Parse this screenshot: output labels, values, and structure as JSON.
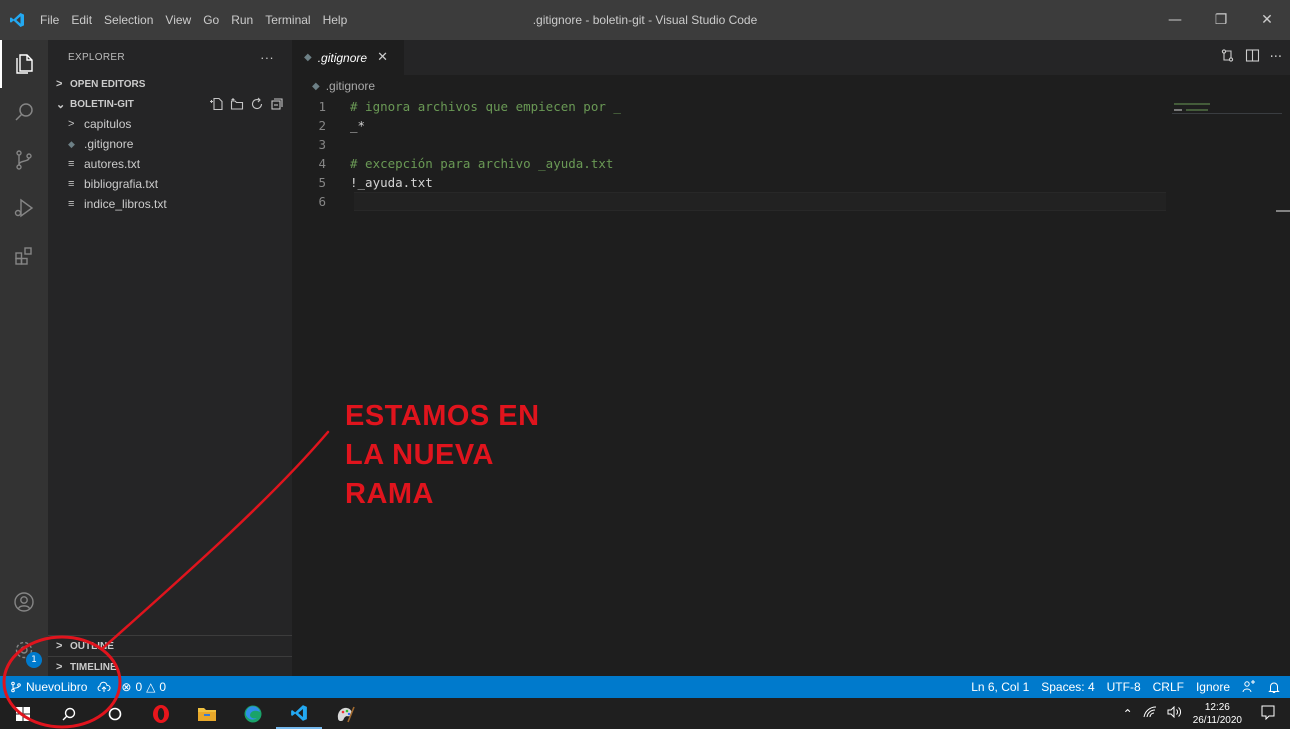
{
  "window": {
    "title": ".gitignore - boletin-git - Visual Studio Code",
    "menu": [
      "File",
      "Edit",
      "Selection",
      "View",
      "Go",
      "Run",
      "Terminal",
      "Help"
    ],
    "controls": {
      "minimize": "—",
      "restore": "❐",
      "close": "✕"
    }
  },
  "activitybar": {
    "icons": [
      "files-icon",
      "search-icon",
      "source-control-icon",
      "run-debug-icon",
      "extensions-icon",
      "account-icon",
      "manage-gear-icon"
    ],
    "manage_badge": "1"
  },
  "sidebar": {
    "title": "EXPLORER",
    "more": "···",
    "open_editors": "OPEN EDITORS",
    "folder": "BOLETIN-GIT",
    "items": [
      {
        "label": "capitulos",
        "kind": "folder"
      },
      {
        "label": ".gitignore",
        "kind": "gitignore"
      },
      {
        "label": "autores.txt",
        "kind": "text"
      },
      {
        "label": "bibliografia.txt",
        "kind": "text"
      },
      {
        "label": "indice_libros.txt",
        "kind": "text"
      }
    ],
    "outline": "OUTLINE",
    "timeline": "TIMELINE"
  },
  "editor": {
    "tab_label": ".gitignore",
    "breadcrumb": ".gitignore",
    "lines": [
      {
        "n": "1",
        "text": "# ignora archivos que empiecen por _",
        "kind": "comment"
      },
      {
        "n": "2",
        "text": "_*",
        "kind": "plain"
      },
      {
        "n": "3",
        "text": "",
        "kind": "plain"
      },
      {
        "n": "4",
        "text": "# excepción para archivo _ayuda.txt",
        "kind": "comment"
      },
      {
        "n": "5",
        "text": "!_ayuda.txt",
        "kind": "plain"
      },
      {
        "n": "6",
        "text": "",
        "kind": "plain"
      }
    ]
  },
  "statusbar": {
    "branch": "NuevoLibro",
    "errors": "0",
    "warnings": "0",
    "position": "Ln 6, Col 1",
    "spaces": "Spaces: 4",
    "encoding": "UTF-8",
    "eol": "CRLF",
    "language": "Ignore"
  },
  "taskbar": {
    "time": "12:26",
    "date": "26/11/2020"
  },
  "annotation": {
    "lines": [
      "ESTAMOS EN",
      "LA NUEVA",
      "RAMA"
    ],
    "color": "#e0141d"
  },
  "colors": {
    "accent": "#007acc",
    "comment": "#6a9955",
    "annotation": "#e0141d"
  }
}
